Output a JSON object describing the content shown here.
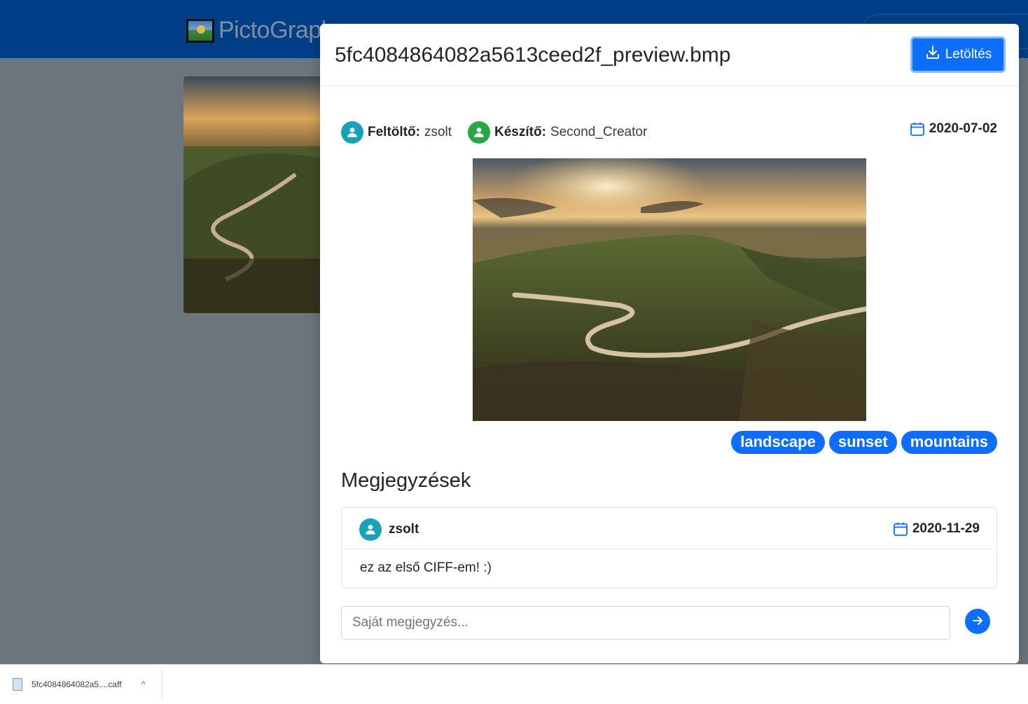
{
  "app": {
    "brand_name": "PictoGraph"
  },
  "modal": {
    "title": "5fc4084864082a5613ceed2f_preview.bmp",
    "download_label": "Letöltés",
    "uploader_label": "Feltöltő:",
    "uploader_value": "zsolt",
    "creator_label": "Készítő:",
    "creator_value": "Second_Creator",
    "date": "2020-07-02",
    "tags": [
      "landscape",
      "sunset",
      "mountains"
    ],
    "comments_title": "Megjegyzések",
    "comments": [
      {
        "user": "zsolt",
        "date": "2020-11-29",
        "text": "ez az első CIFF-em! :)"
      }
    ],
    "comment_placeholder": "Saját megjegyzés..."
  },
  "download_shelf": {
    "file_name": "5fc4084864082a5....caff",
    "chevron": "^"
  },
  "icons": {
    "avatar": "user-icon",
    "calendar": "calendar-icon",
    "download": "download-icon",
    "send": "arrow-right-icon"
  },
  "colors": {
    "navbar": "#003f87",
    "primary": "#0d6efd",
    "teal": "#17a2b8",
    "green": "#28a745",
    "backdrop": "#6c757d"
  }
}
